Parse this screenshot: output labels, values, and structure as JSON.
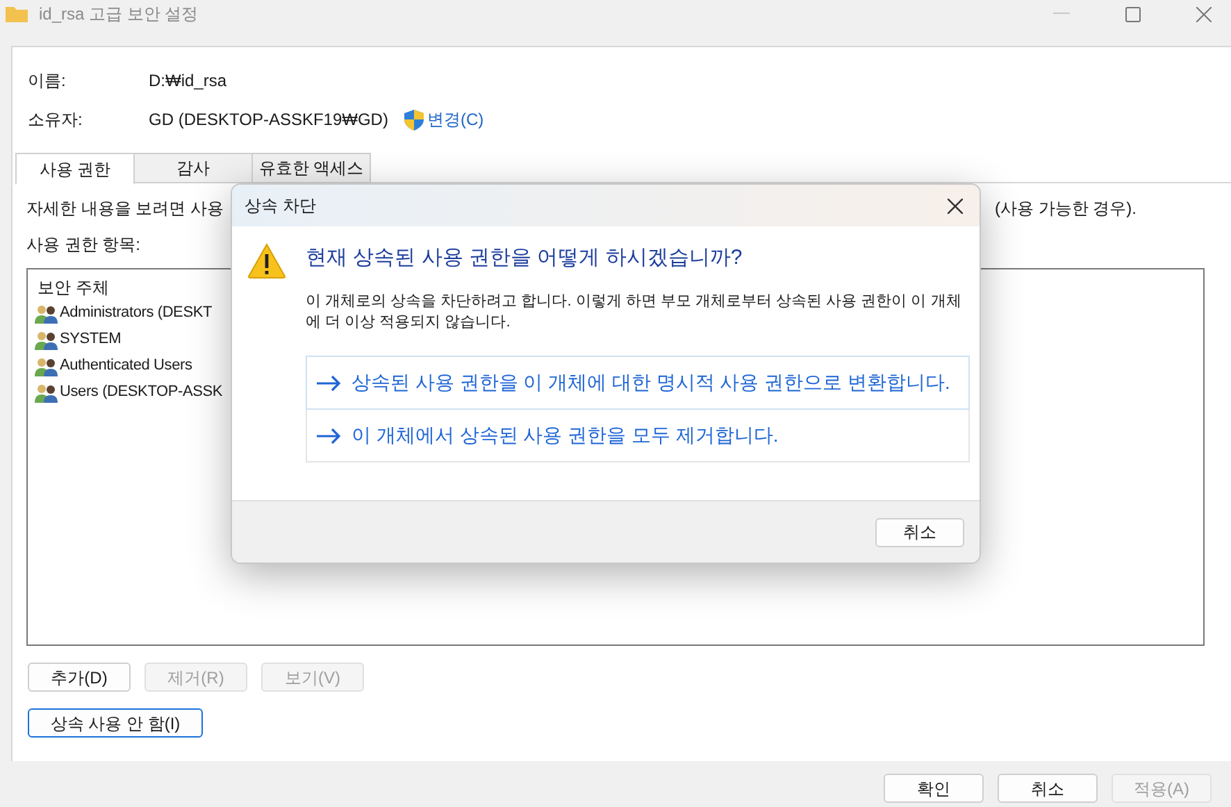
{
  "window": {
    "title": "id_rsa 고급 보안 설정"
  },
  "fields": [
    {
      "label": "이름:",
      "value": "D:₩id_rsa"
    },
    {
      "label": "소유자:",
      "value": "GD (DESKTOP-ASSKF19₩GD)",
      "link": "변경(C)"
    }
  ],
  "tabs": [
    {
      "label": "사용 권한",
      "selected": true
    },
    {
      "label": "감사",
      "selected": false
    },
    {
      "label": "유효한 액세스",
      "selected": false
    }
  ],
  "description_start": "자세한 내용을 보려면 사용",
  "description_end": "(사용 가능한 경우).",
  "list_label": "사용 권한 항목:",
  "column": "보안 주체",
  "principals": [
    "Administrators (DESKT",
    "SYSTEM",
    "Authenticated Users",
    "Users (DESKTOP-ASSK"
  ],
  "entry_buttons": [
    {
      "label": "추가(D)",
      "disabled": false
    },
    {
      "label": "제거(R)",
      "disabled": true
    },
    {
      "label": "보기(V)",
      "disabled": true
    }
  ],
  "inherit_button": "상속 사용 안 함(I)",
  "footer_buttons": [
    {
      "label": "확인",
      "disabled": false
    },
    {
      "label": "취소",
      "disabled": false
    },
    {
      "label": "적용(A)",
      "disabled": true
    }
  ],
  "dialog": {
    "title": "상속 차단",
    "heading": "현재 상속된 사용 권한을 어떻게 하시겠습니까?",
    "body": "이 개체로의 상속을 차단하려고 합니다. 이렇게 하면 부모 개체로부터 상속된 사용 권한이 이 개체에 더 이상 적용되지 않습니다.",
    "options": [
      {
        "label": "상속된 사용 권한을 이 개체에 대한 명시적 사용 권한으로 변환합니다.",
        "selected": true
      },
      {
        "label": "이 개체에서 상속된 사용 권한을 모두 제거합니다.",
        "selected": false
      }
    ],
    "cancel": "취소"
  }
}
